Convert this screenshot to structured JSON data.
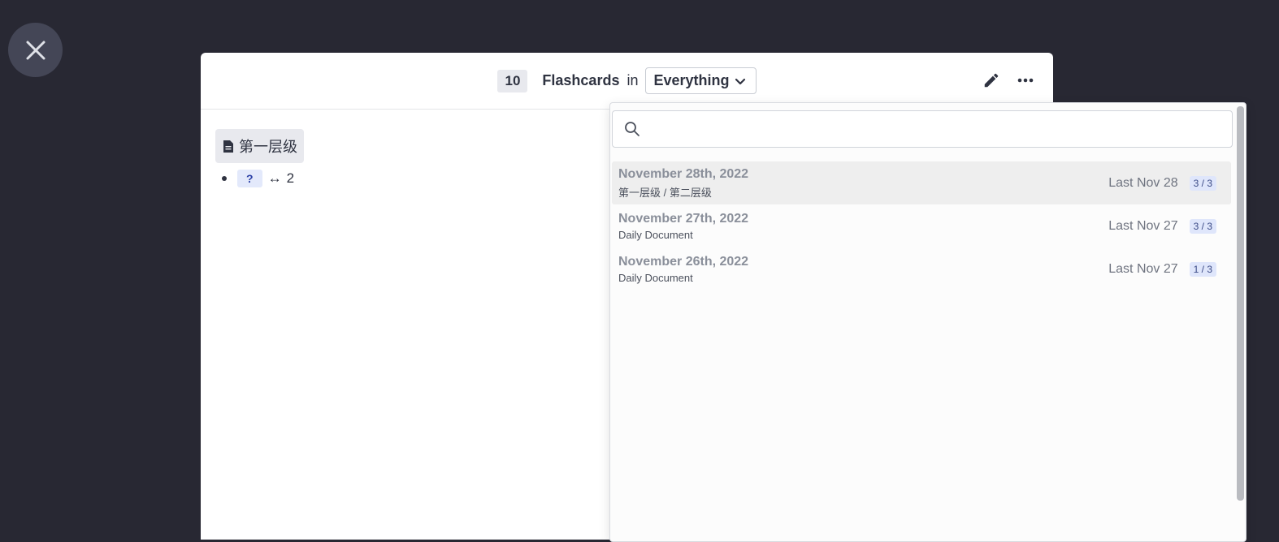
{
  "close": {
    "icon": "close-icon"
  },
  "header": {
    "count": "10",
    "title": "Flashcards",
    "in": "in",
    "deck": "Everything"
  },
  "content": {
    "page_title": "第一层级",
    "cloze": "?",
    "arrow": "↔",
    "value": "2"
  },
  "popup": {
    "search_placeholder": "",
    "items": [
      {
        "title": "November 28th, 2022",
        "sub": "第一层级 / 第二层级",
        "last": "Last Nov 28",
        "ratio": "3 / 3"
      },
      {
        "title": "November 27th, 2022",
        "sub": "Daily Document",
        "last": "Last Nov 27",
        "ratio": "3 / 3"
      },
      {
        "title": "November 26th, 2022",
        "sub": "Daily Document",
        "last": "Last Nov 27",
        "ratio": "1 / 3"
      }
    ]
  }
}
